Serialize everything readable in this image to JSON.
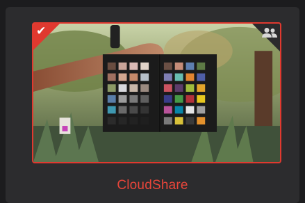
{
  "card": {
    "title": "CloudShare",
    "selected": true
  },
  "icons": {
    "selected": "checkmark-icon",
    "shared": "people-icon"
  },
  "colors": {
    "accent": "#e0392f",
    "title": "#e8453a",
    "background": "#1c1c1e"
  }
}
